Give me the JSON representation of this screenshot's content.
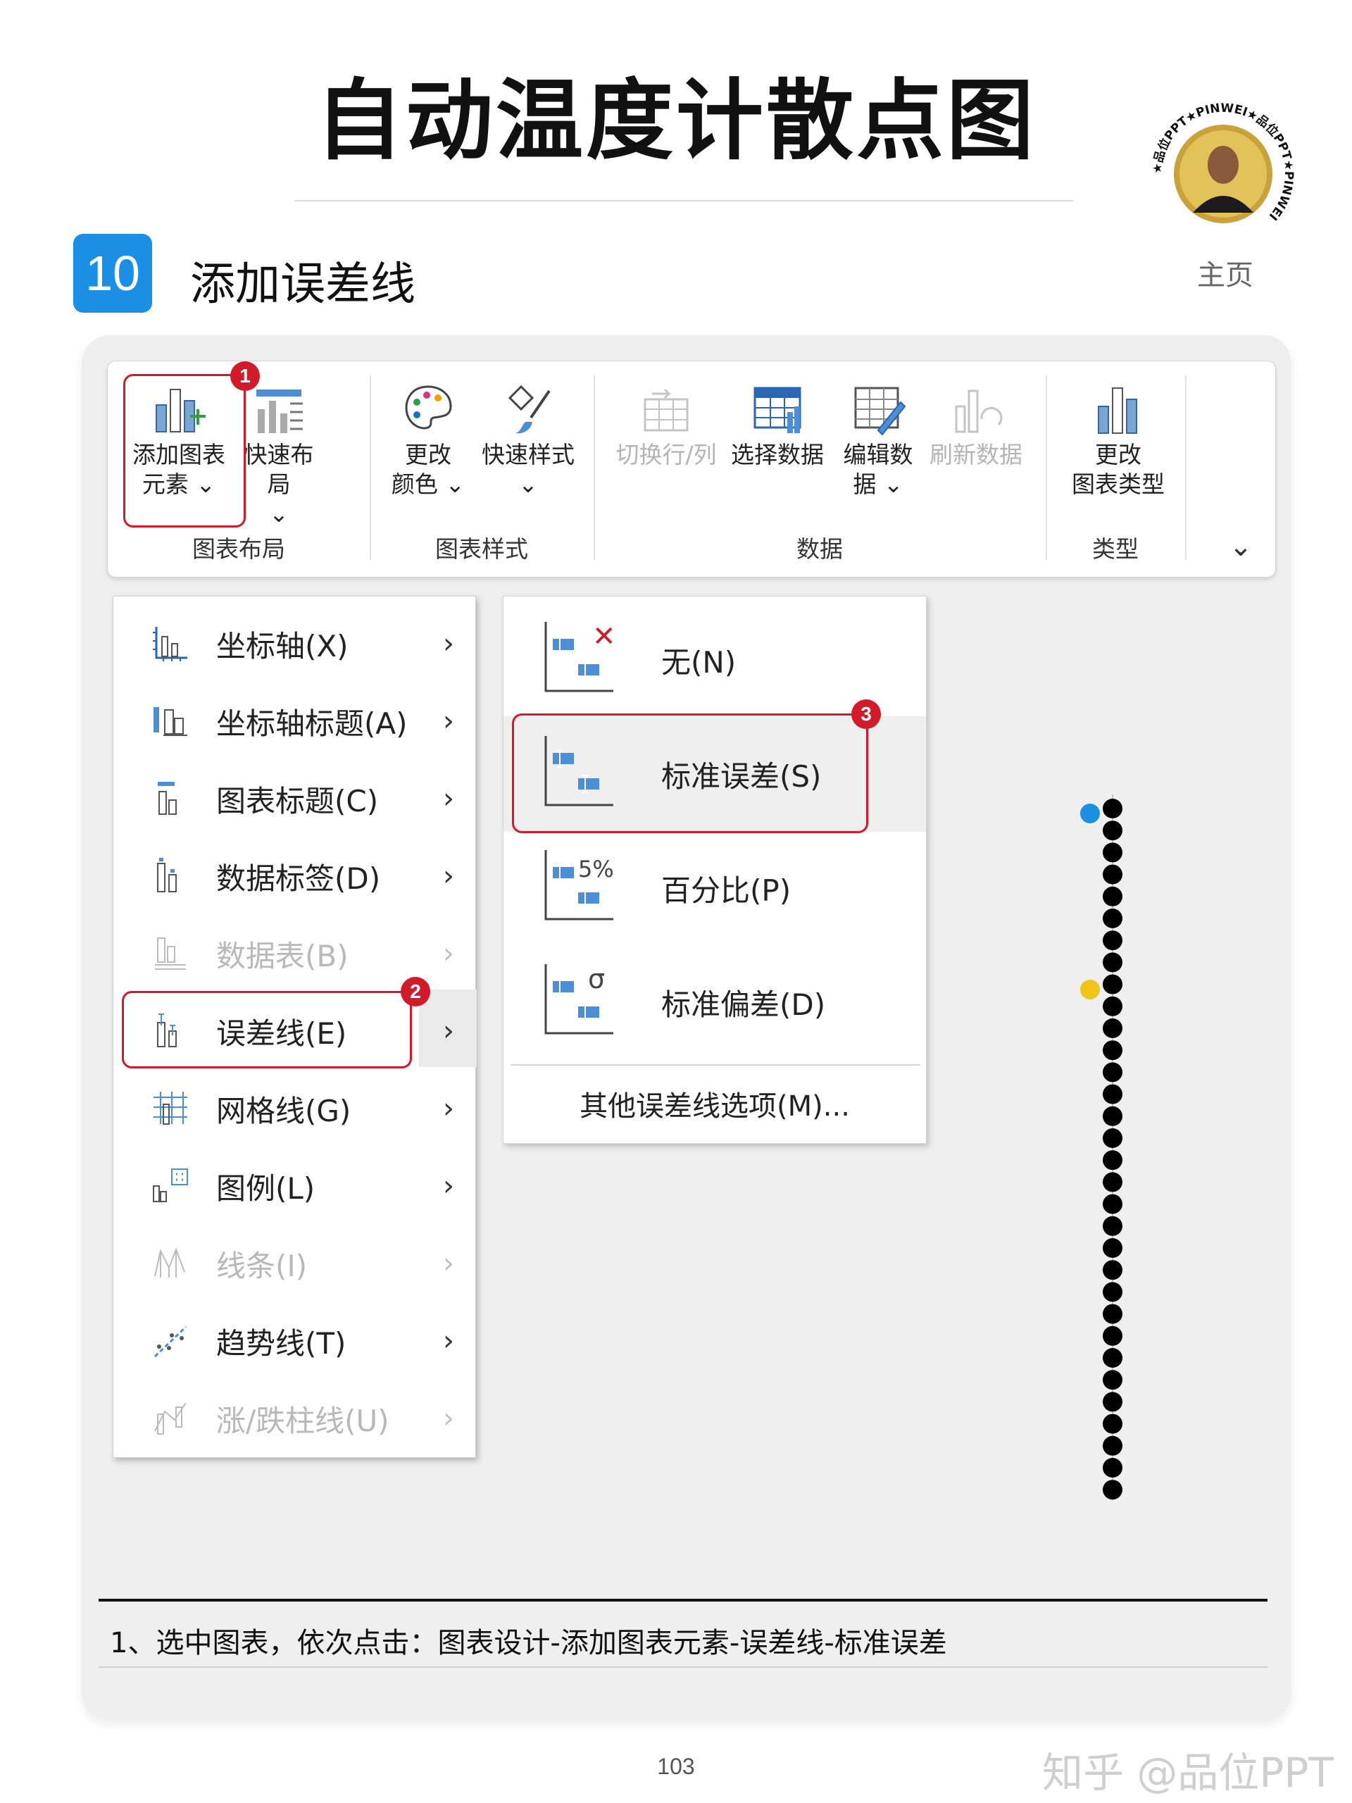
{
  "title": "自动温度计散点图",
  "step": {
    "number": "10",
    "title": "添加误差线"
  },
  "avatar": {
    "ring_text": "★品位PPT★PINWEI★品位PPT★PINWEI",
    "label": "主页"
  },
  "ribbon": {
    "buttons": [
      {
        "label": "添加图表",
        "label2": "元素",
        "chev": "⌄"
      },
      {
        "label": "快速布局",
        "chev": "⌄"
      },
      {
        "label": "更改",
        "label2": "颜色",
        "chev": "⌄"
      },
      {
        "label": "快速样式",
        "chev": "⌄"
      },
      {
        "label": "切换行/列"
      },
      {
        "label": "选择数据"
      },
      {
        "label": "编辑数",
        "label2": "据",
        "chev": "⌄"
      },
      {
        "label": "刷新数据"
      },
      {
        "label": "更改",
        "label2": "图表类型"
      }
    ],
    "groups": [
      "图表布局",
      "图表样式",
      "数据",
      "类型"
    ],
    "collapse": "⌄"
  },
  "badges": [
    "1",
    "2",
    "3"
  ],
  "menu": {
    "items": [
      {
        "label": "坐标轴(X)",
        "icon": "axes-icon"
      },
      {
        "label": "坐标轴标题(A)",
        "icon": "axis-title-icon"
      },
      {
        "label": "图表标题(C)",
        "icon": "chart-title-icon"
      },
      {
        "label": "数据标签(D)",
        "icon": "data-labels-icon"
      },
      {
        "label": "数据表(B)",
        "icon": "data-table-icon"
      },
      {
        "label": "误差线(E)",
        "icon": "error-bars-icon"
      },
      {
        "label": "网格线(G)",
        "icon": "gridlines-icon"
      },
      {
        "label": "图例(L)",
        "icon": "legend-icon"
      },
      {
        "label": "线条(I)",
        "icon": "lines-icon"
      },
      {
        "label": "趋势线(T)",
        "icon": "trendline-icon"
      },
      {
        "label": "涨/跌柱线(U)",
        "icon": "updown-bars-icon"
      }
    ],
    "arrow": "›"
  },
  "submenu": {
    "items": [
      {
        "label": "无(N)",
        "tag": "✕"
      },
      {
        "label": "标准误差(S)",
        "tag": ""
      },
      {
        "label": "百分比(P)",
        "tag": "5%"
      },
      {
        "label": "标准偏差(D)",
        "tag": "σ"
      }
    ],
    "more": "其他误差线选项(M)..."
  },
  "chart_data": {
    "type": "scatter",
    "series": [
      {
        "color": "#000000",
        "marker_count": 32
      },
      {
        "color": "#1a8fe3",
        "marker_count": 1
      },
      {
        "color": "#f0c419",
        "marker_count": 1
      }
    ]
  },
  "caption": "1、选中图表，依次点击：图表设计-添加图表元素-误差线-标准误差",
  "page_number": "103",
  "watermark": "知乎 @品位PPT",
  "colors": {
    "accent": "#1a8fe3",
    "highlight": "#d11a2a"
  }
}
